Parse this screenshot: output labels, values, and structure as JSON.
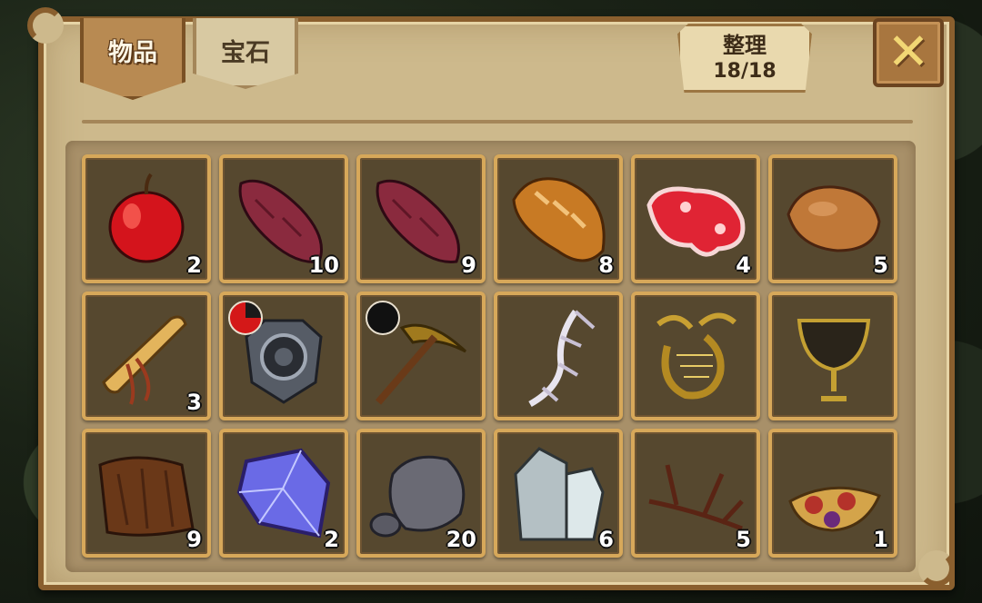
{
  "tabs": [
    {
      "label": "物品",
      "active": true
    },
    {
      "label": "宝石",
      "active": false
    }
  ],
  "sort": {
    "label": "整理",
    "count": "18/18"
  },
  "close_icon": "close-x-icon",
  "colors": {
    "slot_border": "#d7a85a",
    "slot_bg": "#56482f",
    "panel": "#cdb98c",
    "frame": "#8a5f2e"
  },
  "items": [
    {
      "icon": "apple-icon",
      "count": "2"
    },
    {
      "icon": "sweet-potato-icon",
      "count": "10"
    },
    {
      "icon": "sweet-potato-icon",
      "count": "9"
    },
    {
      "icon": "bread-icon",
      "count": "8"
    },
    {
      "icon": "raw-meat-icon",
      "count": "4"
    },
    {
      "icon": "cooked-meat-icon",
      "count": "5"
    },
    {
      "icon": "scroll-icon",
      "count": "3"
    },
    {
      "icon": "shield-gear-icon",
      "count": "",
      "cooldown": "red"
    },
    {
      "icon": "pickaxe-icon",
      "count": "",
      "cooldown": "black"
    },
    {
      "icon": "bone-claw-icon",
      "count": ""
    },
    {
      "icon": "golden-harp-icon",
      "count": ""
    },
    {
      "icon": "goblet-icon",
      "count": ""
    },
    {
      "icon": "bark-icon",
      "count": "9"
    },
    {
      "icon": "crystal-icon",
      "count": "2"
    },
    {
      "icon": "stone-icon",
      "count": "20"
    },
    {
      "icon": "quartz-icon",
      "count": "6"
    },
    {
      "icon": "branch-icon",
      "count": "5"
    },
    {
      "icon": "herb-bundle-icon",
      "count": "1"
    }
  ]
}
